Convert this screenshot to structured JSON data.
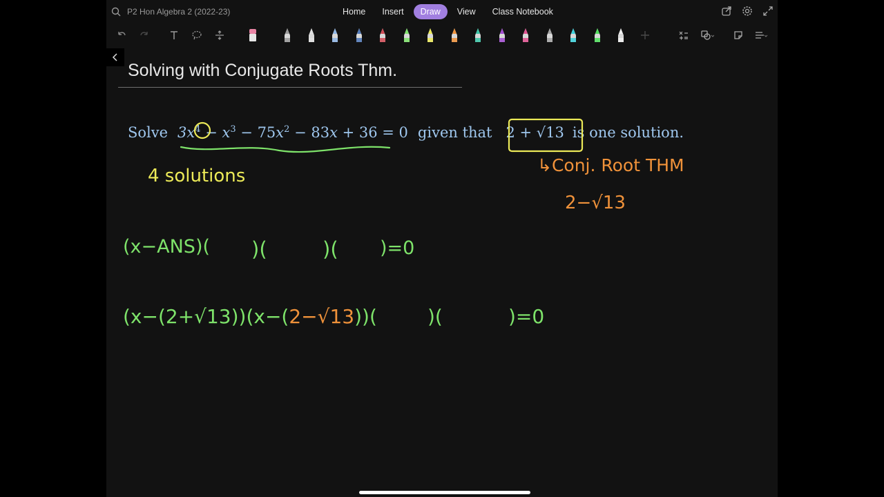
{
  "app": {
    "notebook": "P2 Hon Algebra 2 (2022-23)"
  },
  "tabs": [
    {
      "label": "Home",
      "active": false
    },
    {
      "label": "Insert",
      "active": false
    },
    {
      "label": "Draw",
      "active": true
    },
    {
      "label": "View",
      "active": false
    },
    {
      "label": "Class Notebook",
      "active": false
    }
  ],
  "page": {
    "title": "Solving with Conjugate Roots Thm."
  },
  "problem": {
    "solve_word": "Solve",
    "given_word": "given that",
    "root": "2 + √13",
    "tail": "is one solution."
  },
  "ink": {
    "four_solutions": "4 solutions",
    "conj_root_thm": "↳Conj. Root THM",
    "conj_value": "2−√13",
    "line1_start": "(x−ANS)(",
    "line1_parens": [
      ")(",
      ")(",
      ")=0"
    ],
    "line2_a": "(x−(2+√13))(x−(",
    "line2_b": "2−√13",
    "line2_c": "))(",
    "line2_d": ")(",
    "line2_e": ")=0"
  },
  "colors": {
    "ink_green": "#7ee36a",
    "ink_yellow": "#ecea58",
    "ink_orange": "#f0923a",
    "printed_text": "#9fc7ee",
    "draw_tab": "#a17fe0"
  },
  "pens": [
    {
      "icon": "pencil-gray",
      "color": "#9a9a9a"
    },
    {
      "icon": "pen-white",
      "color": "#e0e0e0"
    },
    {
      "icon": "pen-lightblue",
      "color": "#8fb6e6"
    },
    {
      "icon": "pen-blue",
      "color": "#4f78b8"
    },
    {
      "icon": "pen-red",
      "color": "#d24a55"
    },
    {
      "icon": "pen-green",
      "color": "#7ee36a"
    },
    {
      "icon": "pen-yellow",
      "color": "#ecea58"
    },
    {
      "icon": "pen-orange",
      "color": "#f0923a"
    },
    {
      "icon": "pen-teal",
      "color": "#38c6a7"
    },
    {
      "icon": "pen-purple",
      "color": "#a24ad2"
    },
    {
      "icon": "pen-pink",
      "color": "#e0508f"
    },
    {
      "icon": "pen-silver",
      "color": "#a5a5a5"
    },
    {
      "icon": "highlighter-cyan",
      "color": "#3ad1dc"
    },
    {
      "icon": "highlighter-green",
      "color": "#4ee05a"
    },
    {
      "icon": "pen-white-2",
      "color": "#f0f0f0"
    }
  ]
}
